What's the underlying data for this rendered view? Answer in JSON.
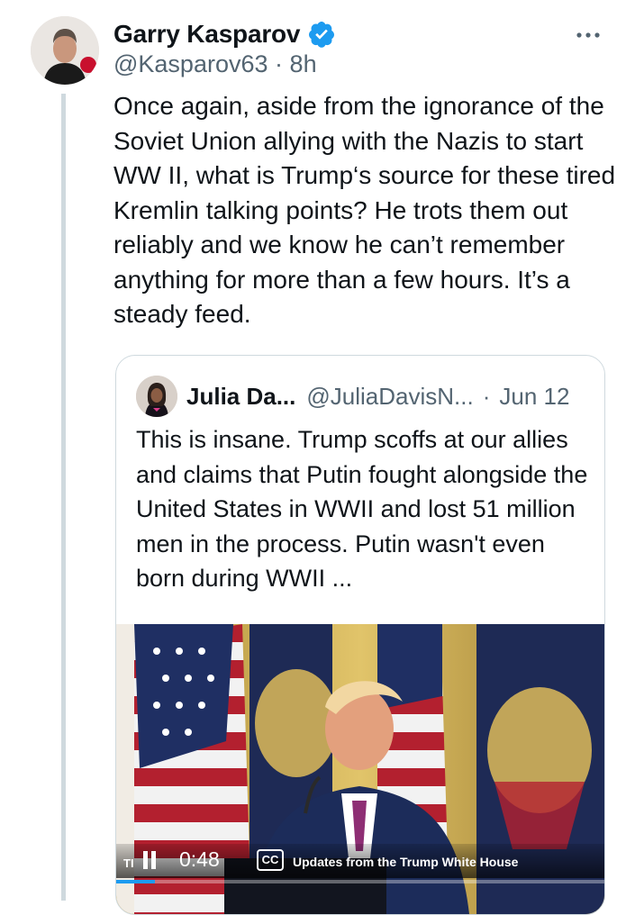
{
  "tweet": {
    "author_name": "Garry Kasparov",
    "handle": "@Kasparov63",
    "separator": "·",
    "time": "8h",
    "text": "Once again, aside from the ignorance of the Soviet Union allying with the Nazis to start WW II, what is Trump‘s source for these tired Kremlin talking points? He trots them out reliably and we know he can’t remember anything for more than a few hours. It’s a steady feed."
  },
  "quote": {
    "author_name": "Julia Da...",
    "handle": "@JuliaDavisN...",
    "separator": "·",
    "date": "Jun 12",
    "text": "This is insane. Trump scoffs at our allies and claims that Putin fought alongside the United States in WWII and lost 51 million men in the process. Putin wasn't even born during WWII ..."
  },
  "video": {
    "time": "0:48",
    "cc_label": "CC",
    "ticker_text": "Updates from the Trump White House",
    "progress": 0.08
  },
  "icons": {
    "verified": "verified-badge-icon",
    "more": "more-options-icon",
    "pause": "pause-icon",
    "cc": "closed-captions-icon"
  },
  "colors": {
    "verified_blue": "#1d9bf0",
    "secondary_text": "#536471",
    "border": "#cfd9de"
  }
}
